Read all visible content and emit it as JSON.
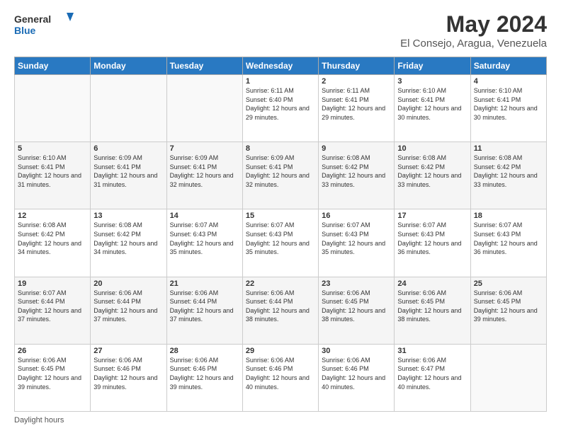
{
  "logo": {
    "line1": "General",
    "line2": "Blue"
  },
  "title": "May 2024",
  "subtitle": "El Consejo, Aragua, Venezuela",
  "weekdays": [
    "Sunday",
    "Monday",
    "Tuesday",
    "Wednesday",
    "Thursday",
    "Friday",
    "Saturday"
  ],
  "weeks": [
    [
      {
        "day": "",
        "sunrise": "",
        "sunset": "",
        "daylight": ""
      },
      {
        "day": "",
        "sunrise": "",
        "sunset": "",
        "daylight": ""
      },
      {
        "day": "",
        "sunrise": "",
        "sunset": "",
        "daylight": ""
      },
      {
        "day": "1",
        "sunrise": "6:11 AM",
        "sunset": "6:40 PM",
        "daylight": "12 hours and 29 minutes."
      },
      {
        "day": "2",
        "sunrise": "6:11 AM",
        "sunset": "6:41 PM",
        "daylight": "12 hours and 29 minutes."
      },
      {
        "day": "3",
        "sunrise": "6:10 AM",
        "sunset": "6:41 PM",
        "daylight": "12 hours and 30 minutes."
      },
      {
        "day": "4",
        "sunrise": "6:10 AM",
        "sunset": "6:41 PM",
        "daylight": "12 hours and 30 minutes."
      }
    ],
    [
      {
        "day": "5",
        "sunrise": "6:10 AM",
        "sunset": "6:41 PM",
        "daylight": "12 hours and 31 minutes."
      },
      {
        "day": "6",
        "sunrise": "6:09 AM",
        "sunset": "6:41 PM",
        "daylight": "12 hours and 31 minutes."
      },
      {
        "day": "7",
        "sunrise": "6:09 AM",
        "sunset": "6:41 PM",
        "daylight": "12 hours and 32 minutes."
      },
      {
        "day": "8",
        "sunrise": "6:09 AM",
        "sunset": "6:41 PM",
        "daylight": "12 hours and 32 minutes."
      },
      {
        "day": "9",
        "sunrise": "6:08 AM",
        "sunset": "6:42 PM",
        "daylight": "12 hours and 33 minutes."
      },
      {
        "day": "10",
        "sunrise": "6:08 AM",
        "sunset": "6:42 PM",
        "daylight": "12 hours and 33 minutes."
      },
      {
        "day": "11",
        "sunrise": "6:08 AM",
        "sunset": "6:42 PM",
        "daylight": "12 hours and 33 minutes."
      }
    ],
    [
      {
        "day": "12",
        "sunrise": "6:08 AM",
        "sunset": "6:42 PM",
        "daylight": "12 hours and 34 minutes."
      },
      {
        "day": "13",
        "sunrise": "6:08 AM",
        "sunset": "6:42 PM",
        "daylight": "12 hours and 34 minutes."
      },
      {
        "day": "14",
        "sunrise": "6:07 AM",
        "sunset": "6:43 PM",
        "daylight": "12 hours and 35 minutes."
      },
      {
        "day": "15",
        "sunrise": "6:07 AM",
        "sunset": "6:43 PM",
        "daylight": "12 hours and 35 minutes."
      },
      {
        "day": "16",
        "sunrise": "6:07 AM",
        "sunset": "6:43 PM",
        "daylight": "12 hours and 35 minutes."
      },
      {
        "day": "17",
        "sunrise": "6:07 AM",
        "sunset": "6:43 PM",
        "daylight": "12 hours and 36 minutes."
      },
      {
        "day": "18",
        "sunrise": "6:07 AM",
        "sunset": "6:43 PM",
        "daylight": "12 hours and 36 minutes."
      }
    ],
    [
      {
        "day": "19",
        "sunrise": "6:07 AM",
        "sunset": "6:44 PM",
        "daylight": "12 hours and 37 minutes."
      },
      {
        "day": "20",
        "sunrise": "6:06 AM",
        "sunset": "6:44 PM",
        "daylight": "12 hours and 37 minutes."
      },
      {
        "day": "21",
        "sunrise": "6:06 AM",
        "sunset": "6:44 PM",
        "daylight": "12 hours and 37 minutes."
      },
      {
        "day": "22",
        "sunrise": "6:06 AM",
        "sunset": "6:44 PM",
        "daylight": "12 hours and 38 minutes."
      },
      {
        "day": "23",
        "sunrise": "6:06 AM",
        "sunset": "6:45 PM",
        "daylight": "12 hours and 38 minutes."
      },
      {
        "day": "24",
        "sunrise": "6:06 AM",
        "sunset": "6:45 PM",
        "daylight": "12 hours and 38 minutes."
      },
      {
        "day": "25",
        "sunrise": "6:06 AM",
        "sunset": "6:45 PM",
        "daylight": "12 hours and 39 minutes."
      }
    ],
    [
      {
        "day": "26",
        "sunrise": "6:06 AM",
        "sunset": "6:45 PM",
        "daylight": "12 hours and 39 minutes."
      },
      {
        "day": "27",
        "sunrise": "6:06 AM",
        "sunset": "6:46 PM",
        "daylight": "12 hours and 39 minutes."
      },
      {
        "day": "28",
        "sunrise": "6:06 AM",
        "sunset": "6:46 PM",
        "daylight": "12 hours and 39 minutes."
      },
      {
        "day": "29",
        "sunrise": "6:06 AM",
        "sunset": "6:46 PM",
        "daylight": "12 hours and 40 minutes."
      },
      {
        "day": "30",
        "sunrise": "6:06 AM",
        "sunset": "6:46 PM",
        "daylight": "12 hours and 40 minutes."
      },
      {
        "day": "31",
        "sunrise": "6:06 AM",
        "sunset": "6:47 PM",
        "daylight": "12 hours and 40 minutes."
      },
      {
        "day": "",
        "sunrise": "",
        "sunset": "",
        "daylight": ""
      }
    ]
  ],
  "footer": "Daylight hours"
}
